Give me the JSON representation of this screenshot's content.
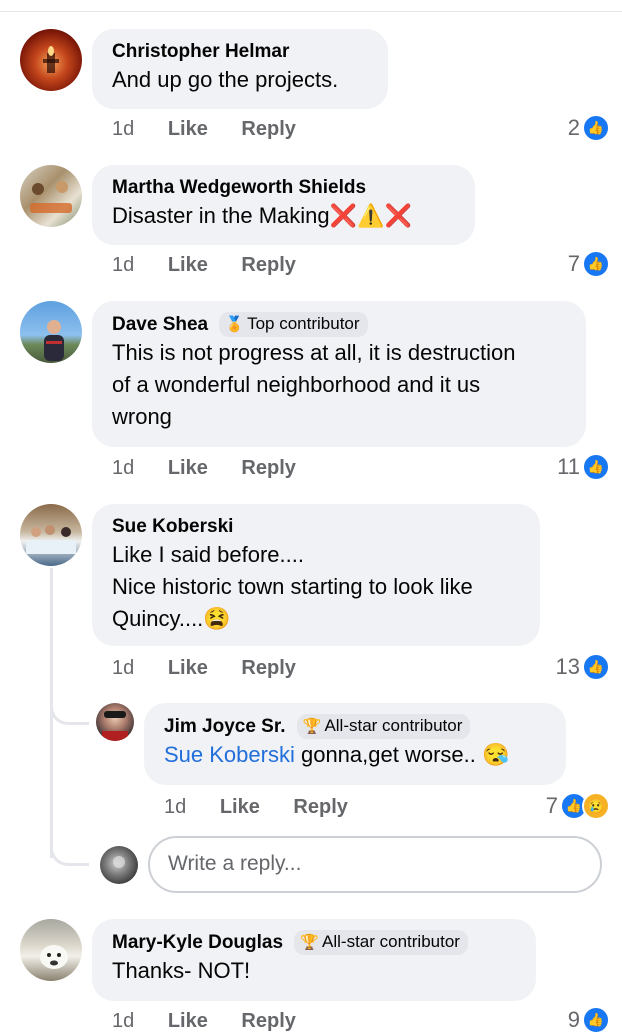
{
  "comments": [
    {
      "author": "Christopher Helmar",
      "badge": "",
      "text": [
        "And up go the projects."
      ],
      "time": "1d",
      "like": "Like",
      "reply": "Reply",
      "reactions": "2",
      "avatar": {
        "bg": "#8a1e0e",
        "desc": "candle-cross"
      }
    },
    {
      "author": "Martha Wedgeworth Shields",
      "badge": "",
      "text": [
        "Disaster in the Making"
      ],
      "emoji": "❌⚠️❌",
      "time": "1d",
      "like": "Like",
      "reply": "Reply",
      "reactions": "7"
    },
    {
      "author": "Dave Shea",
      "badge": "Top contributor",
      "text": [
        "This is not progress at all, it is destruction",
        "of a wonderful neighborhood and it us",
        "wrong"
      ],
      "time": "1d",
      "like": "Like",
      "reply": "Reply",
      "reactions": "11"
    },
    {
      "author": "Sue Koberski",
      "badge": "",
      "text": [
        "Like I said before....",
        "Nice historic town starting to look like",
        "Quincy...."
      ],
      "emoji": "😫",
      "time": "1d",
      "like": "Like",
      "reply": "Reply",
      "reactions": "13"
    },
    {
      "author": "Jim Joyce Sr.",
      "badge": "All-star contributor",
      "mention": "Sue Koberski",
      "text": [
        " gonna,get worse.. "
      ],
      "emoji": "😪",
      "time": "1d",
      "like": "Like",
      "reply": "Reply",
      "reactions": "7"
    },
    {
      "author": "Mary-Kyle Douglas",
      "badge": "All-star contributor",
      "text": [
        "Thanks- NOT!"
      ],
      "time": "1d",
      "like": "Like",
      "reply": "Reply",
      "reactions": "9"
    }
  ],
  "reply_box": {
    "placeholder": "Write a reply..."
  },
  "colors": {
    "like_blue": "#1877f2",
    "mention_blue": "#216fdb",
    "bubble": "#f0f2f5",
    "meta_gray": "#65676b"
  }
}
